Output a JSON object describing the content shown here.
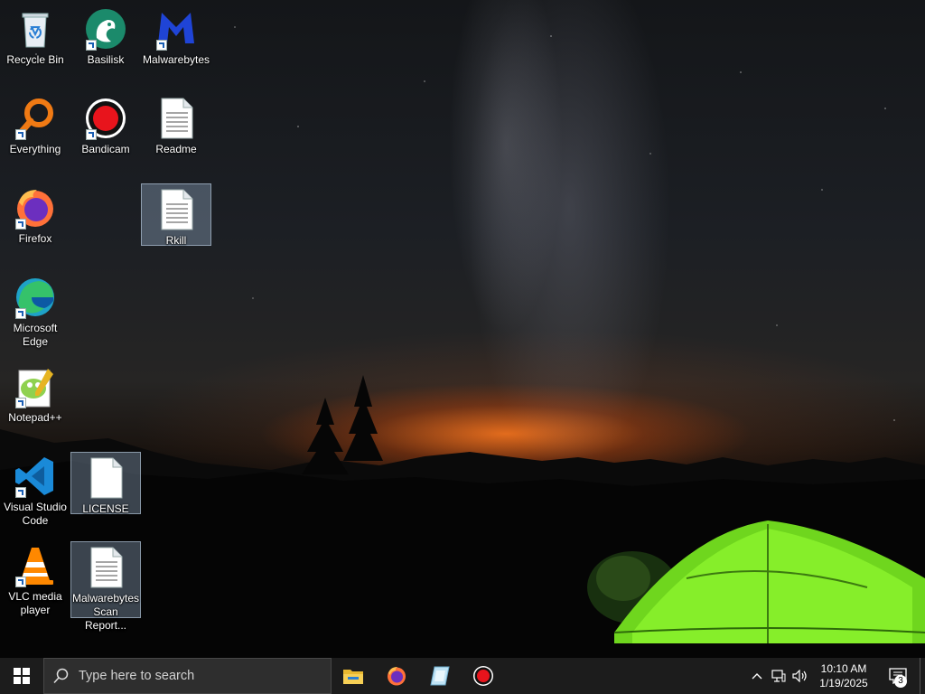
{
  "desktop": {
    "icons": [
      {
        "label": "Recycle Bin",
        "icon": "recycle-bin-icon",
        "shortcut": false
      },
      {
        "label": "Basilisk",
        "icon": "basilisk-icon",
        "shortcut": true
      },
      {
        "label": "Malwarebytes",
        "icon": "malwarebytes-icon",
        "shortcut": true
      },
      {
        "label": "Everything",
        "icon": "everything-icon",
        "shortcut": true
      },
      {
        "label": "Bandicam",
        "icon": "bandicam-icon",
        "shortcut": true
      },
      {
        "label": "Readme",
        "icon": "text-file-icon",
        "shortcut": false
      },
      {
        "label": "Firefox",
        "icon": "firefox-icon",
        "shortcut": true
      },
      {
        "label": "Rkill",
        "icon": "text-file-icon",
        "shortcut": false,
        "selected": true
      },
      {
        "label": "Microsoft Edge",
        "icon": "edge-icon",
        "shortcut": true
      },
      {
        "label": "Notepad++",
        "icon": "notepadpp-icon",
        "shortcut": true
      },
      {
        "label": "Visual Studio Code",
        "icon": "vscode-icon",
        "shortcut": true
      },
      {
        "label": "LICENSE",
        "icon": "blank-file-icon",
        "shortcut": false,
        "selected": true
      },
      {
        "label": "VLC media player",
        "icon": "vlc-icon",
        "shortcut": true
      },
      {
        "label": "Malwarebytes Scan Report...",
        "icon": "text-file-icon",
        "shortcut": false,
        "selected": true
      }
    ]
  },
  "taskbar": {
    "start_icon": "windows-logo-icon",
    "search_placeholder": "Type here to search",
    "pinned_apps": [
      {
        "name": "File Explorer",
        "icon": "file-explorer-icon"
      },
      {
        "name": "Firefox",
        "icon": "firefox-icon"
      },
      {
        "name": "Rkill",
        "icon": "rkill-icon"
      },
      {
        "name": "Bandicam",
        "icon": "bandicam-icon"
      }
    ],
    "tray": {
      "icons": [
        "chevron-up-icon",
        "network-icon",
        "volume-icon"
      ],
      "time": "10:10 AM",
      "date": "1/19/2025",
      "notification_count": "3"
    }
  },
  "colors": {
    "taskbar_bg": "#1c1c1c",
    "search_bg": "#2e2e2e",
    "selection": "#a0b9d7"
  }
}
